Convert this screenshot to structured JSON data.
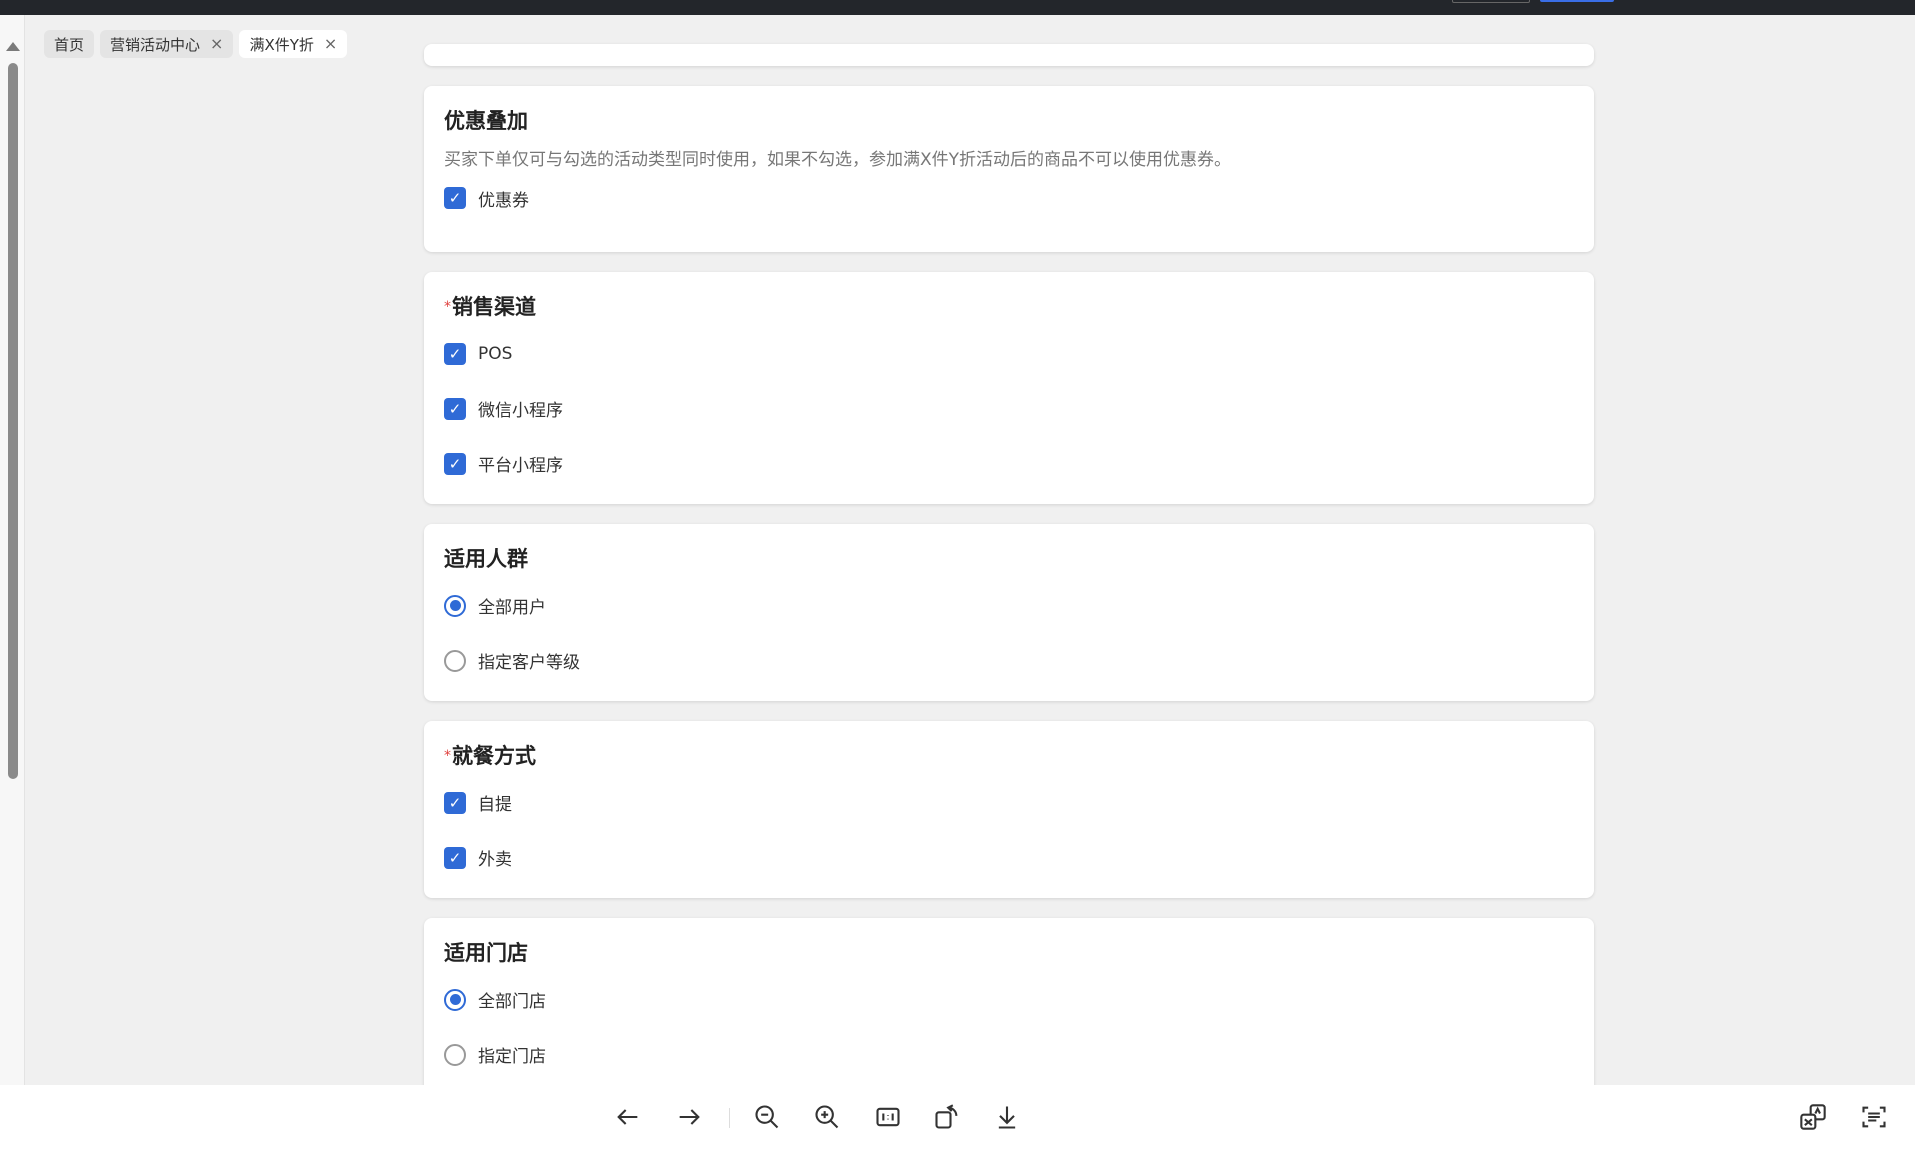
{
  "tabs": [
    {
      "label": "首页",
      "closable": false,
      "active": false
    },
    {
      "label": "营销活动中心",
      "closable": true,
      "active": false
    },
    {
      "label": "满X件Y折",
      "closable": true,
      "active": true
    }
  ],
  "tab_close_glyph": "×",
  "sections": {
    "discount_stack": {
      "title": "优惠叠加",
      "description": "买家下单仅可与勾选的活动类型同时使用，如果不勾选，参加满X件Y折活动后的商品不可以使用优惠券。",
      "options": [
        {
          "label": "优惠券",
          "checked": true
        }
      ]
    },
    "sales_channel": {
      "required_mark": "*",
      "title": "销售渠道",
      "options": [
        {
          "label": "POS",
          "checked": true
        },
        {
          "label": "微信小程序",
          "checked": true
        },
        {
          "label": "平台小程序",
          "checked": true
        }
      ]
    },
    "audience": {
      "title": "适用人群",
      "options": [
        {
          "label": "全部用户",
          "selected": true
        },
        {
          "label": "指定客户等级",
          "selected": false
        }
      ]
    },
    "dining_method": {
      "required_mark": "*",
      "title": "就餐方式",
      "options": [
        {
          "label": "自提",
          "checked": true
        },
        {
          "label": "外卖",
          "checked": true
        }
      ]
    },
    "stores": {
      "title": "适用门店",
      "options": [
        {
          "label": "全部门店",
          "selected": true
        },
        {
          "label": "指定门店",
          "selected": false
        }
      ]
    }
  },
  "checkmark_glyph": "✓",
  "colors": {
    "primary": "#2f6ad6",
    "required": "#e0413e",
    "topbar": "#23262b"
  },
  "viewer_toolbar": {
    "icons": [
      "arrow-left-icon",
      "arrow-right-icon",
      "zoom-out-icon",
      "zoom-in-icon",
      "actual-size-icon",
      "rotate-icon",
      "download-icon",
      "translate-icon",
      "text-recognition-icon"
    ]
  }
}
